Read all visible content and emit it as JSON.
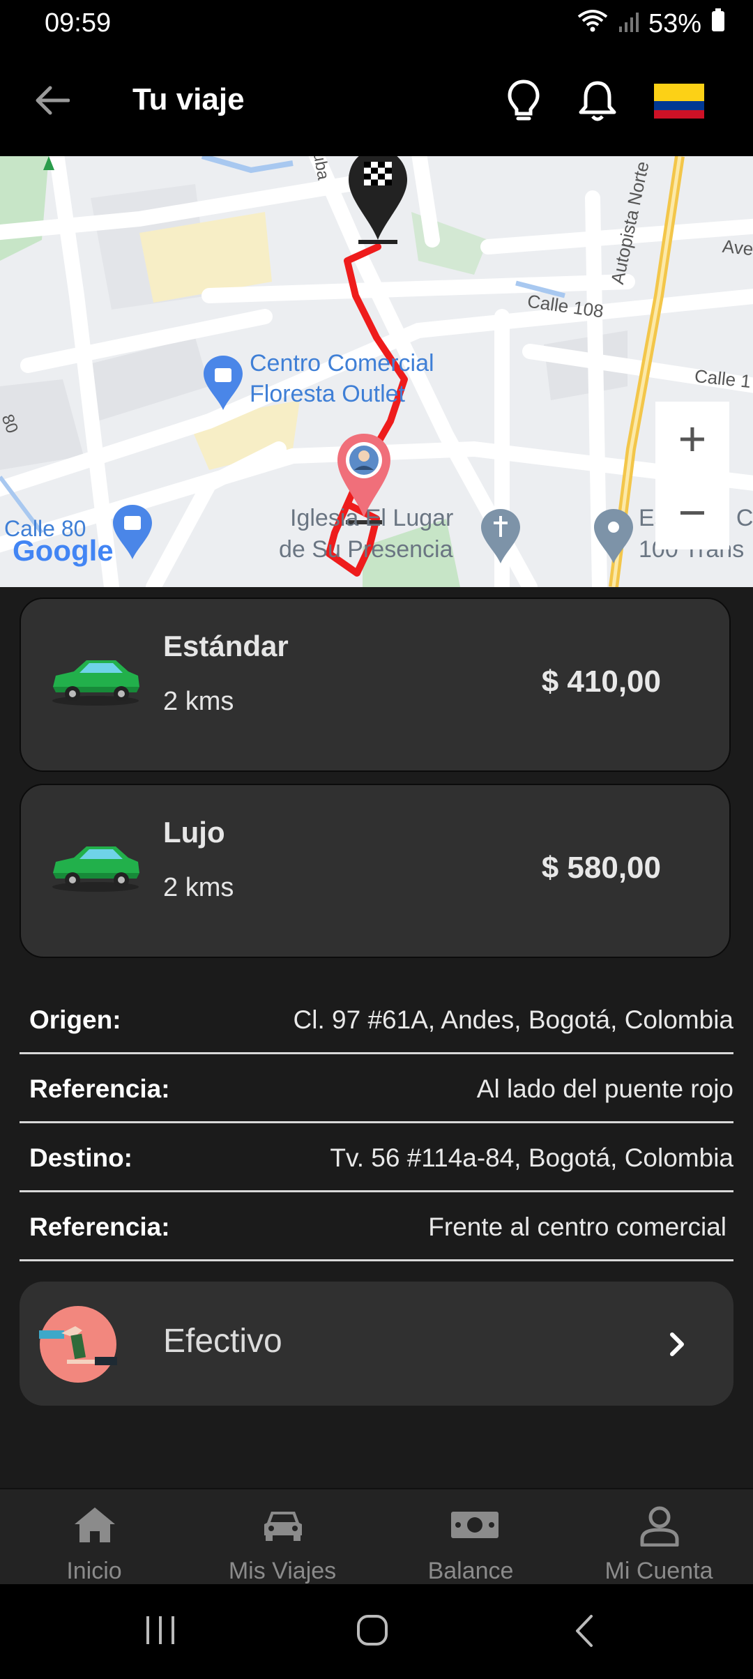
{
  "status_bar": {
    "time": "09:59",
    "battery": "53%"
  },
  "app_bar": {
    "title": "Tu viaje"
  },
  "map": {
    "labels": {
      "mall_line1": "Centro Comercial",
      "mall_line2": "Floresta Outlet",
      "church_line1": "Iglesia El Lugar",
      "church_line2": "de Su Presencia",
      "station_line1": "Estación C",
      "station_line2": "100 Trans",
      "calle80": "Calle 80",
      "calle108": "Calle 108",
      "autopista": "Autopista Norte",
      "calle_right": "Calle 1",
      "ave": "Ave",
      "cuba": "uba",
      "left80": "80",
      "google": "Google"
    },
    "zoom_in": "+",
    "zoom_out": "−"
  },
  "vehicles": [
    {
      "name": "Estándar",
      "distance": "2 kms",
      "price": "$ 410,00"
    },
    {
      "name": "Lujo",
      "distance": "2 kms",
      "price": "$ 580,00"
    }
  ],
  "trip_info": [
    {
      "label": "Origen:",
      "value": "Cl. 97 #61A, Andes, Bogotá, Colombia"
    },
    {
      "label": "Referencia:",
      "value": "Al lado del puente rojo"
    },
    {
      "label": "Destino:",
      "value": "Tv. 56 #114a-84, Bogotá, Colombia"
    },
    {
      "label": "Referencia:",
      "value": "Frente al centro comercial"
    }
  ],
  "payment": {
    "label": "Efectivo"
  },
  "bottom_nav": [
    {
      "label": "Inicio",
      "icon": "home-icon"
    },
    {
      "label": "Mis Viajes",
      "icon": "car-icon"
    },
    {
      "label": "Balance",
      "icon": "money-icon"
    },
    {
      "label": "Mi Cuenta",
      "icon": "user-icon"
    }
  ],
  "colors": {
    "route": "#ee1c1c",
    "car_green": "#22b04b",
    "card_bg": "#303030"
  }
}
